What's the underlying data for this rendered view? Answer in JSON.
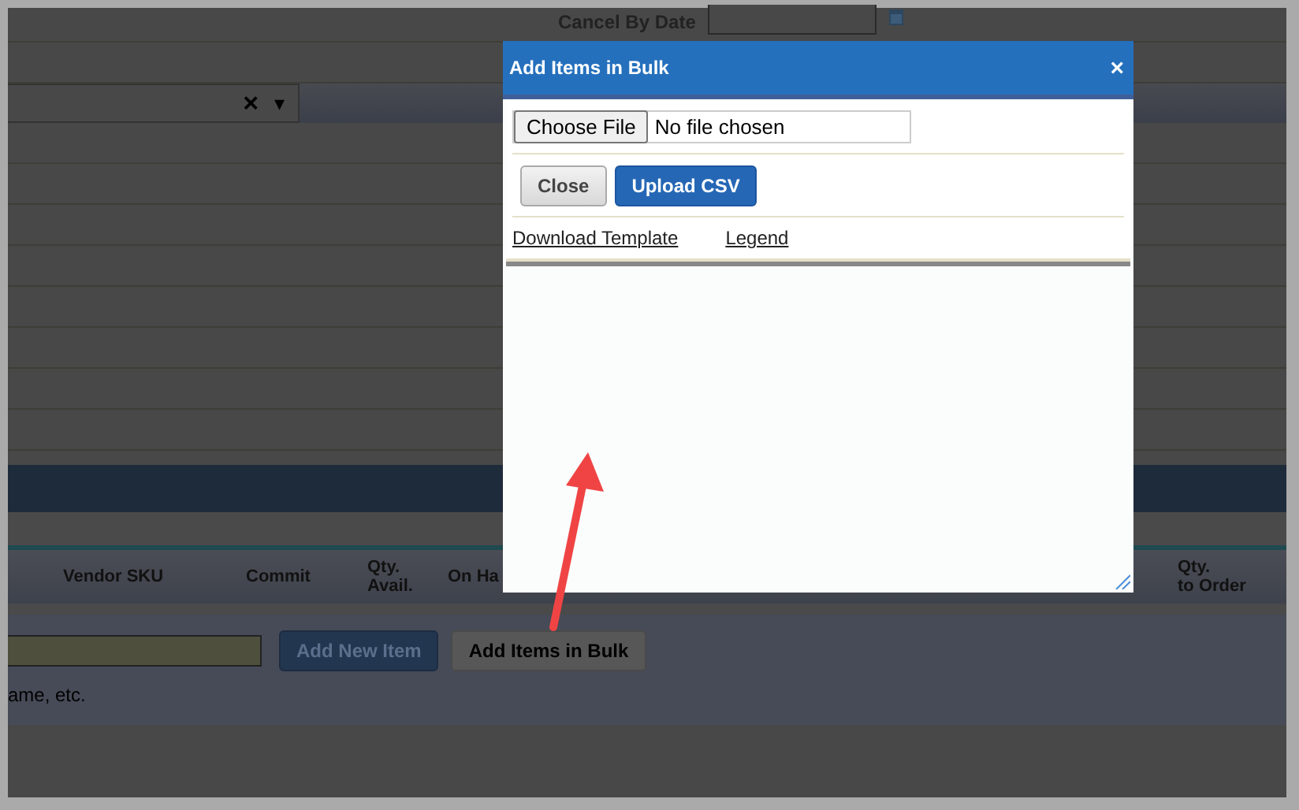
{
  "background_page": {
    "cancel_by_date_label": "Cancel By Date",
    "dropdown": {
      "clear": "×",
      "caret": "▾"
    },
    "table_headers": [
      "Vendor SKU",
      "Commit",
      "Qty.\nAvail.",
      "On Ha",
      "Qty.\nto Order"
    ],
    "item_buttons": [
      {
        "label": "Add New Item",
        "kind": "primary"
      },
      {
        "label": "Add Items in Bulk",
        "kind": "secondary"
      }
    ],
    "hint": "ame, etc."
  },
  "modal": {
    "title": "Add Items in Bulk",
    "close": "×",
    "file_button": "Choose File",
    "file_status": "No file chosen",
    "buttons": [
      {
        "label": "Close",
        "kind": "secondary"
      },
      {
        "label": "Upload CSV",
        "kind": "primary"
      }
    ],
    "links": [
      "Download Template",
      "Legend"
    ]
  }
}
